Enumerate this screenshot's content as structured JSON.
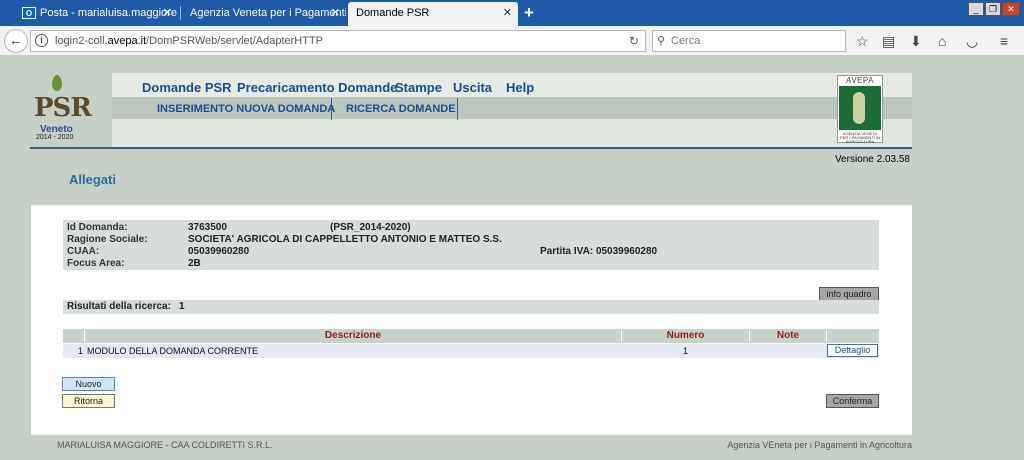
{
  "browser": {
    "tabs": [
      {
        "label": "Posta - marialuisa.maggiore@...",
        "icon": "outlook-icon"
      },
      {
        "label": "Agenzia Veneta per i Pagamenti in...",
        "icon": ""
      },
      {
        "label": "Domande PSR",
        "icon": ""
      }
    ],
    "new_tab": "+",
    "url_prefix": "login2-coll.",
    "url_domain": "avepa.it",
    "url_path": "/DomPSRWeb/servlet/AdapterHTTP",
    "search_placeholder": "Cerca"
  },
  "header": {
    "logo_text": "PSR",
    "logo_region": "Veneto",
    "logo_years": "2014 - 2020",
    "menu": [
      "Domande PSR",
      "Precaricamento Domande",
      "Stampe",
      "Uscita",
      "Help"
    ],
    "submenu": [
      "INSERIMENTO NUOVA DOMANDA",
      "RICERCA DOMANDE"
    ],
    "avepa_logo": "AVEPA",
    "avepa_fine": "AGENZIA VENETA PER I PAGAMENTI IN AGRICOLTURA"
  },
  "version": "Versione 2.03.58",
  "page_title": "Allegati",
  "info": {
    "id_label": "Id Domanda:",
    "id_value": "3763500",
    "id_extra": "(PSR_2014-2020)",
    "ragione_label": "Ragione Sociale:",
    "ragione_value": "SOCIETA' AGRICOLA DI CAPPELLETTO ANTONIO E MATTEO S.S.",
    "cuaa_label": "CUAA:",
    "cuaa_value": "05039960280",
    "piva_text": "Partita IVA: 05039960280",
    "focus_label": "Focus Area:",
    "focus_value": "2B"
  },
  "info_quadro": "info quadro",
  "results": {
    "label": "Risultati della ricerca:",
    "count": "1"
  },
  "table": {
    "headers": {
      "descrizione": "Descrizione",
      "numero": "Numero",
      "note": "Note"
    },
    "rows": [
      {
        "index": "1",
        "descrizione": "MODULO DELLA DOMANDA CORRENTE",
        "numero": "1",
        "note": "",
        "action": "Dettaglio"
      }
    ]
  },
  "buttons": {
    "nuovo": "Nuovo",
    "ritorna": "Ritorna",
    "conferma": "Conferma"
  },
  "footer": {
    "left": "MARIALUISA MAGGIORE - CAA COLDIRETTI S.R.L.",
    "right": "Agenzia VEneta per i Pagamenti in Agricoltura"
  }
}
